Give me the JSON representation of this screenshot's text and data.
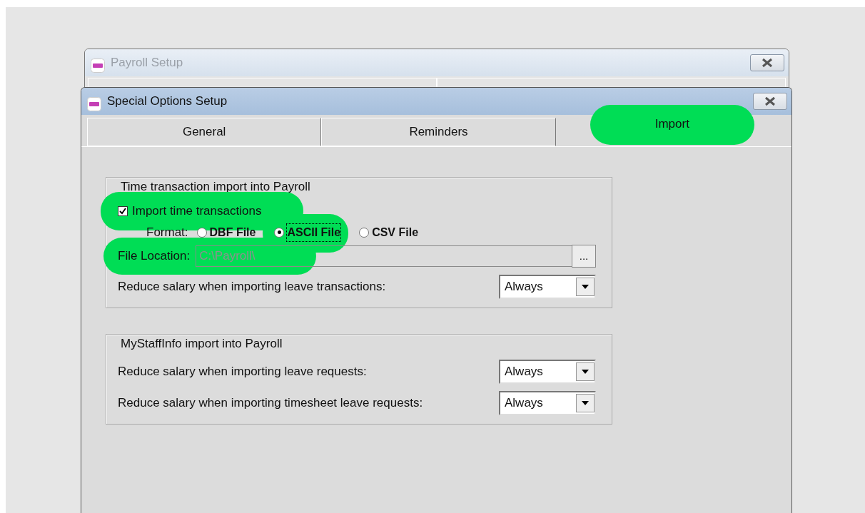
{
  "back_window": {
    "title": "Payroll Setup"
  },
  "window": {
    "title": "Special Options Setup"
  },
  "tabs": [
    {
      "label": "General",
      "selected": false,
      "highlighted": false
    },
    {
      "label": "Reminders",
      "selected": false,
      "highlighted": false
    },
    {
      "label": "Import",
      "selected": true,
      "highlighted": true
    }
  ],
  "groups": [
    {
      "title": "Time transaction import into Payroll",
      "rows": [
        {
          "kind": "checkbox",
          "label": "Import time transactions",
          "checked": true,
          "highlighted": true
        },
        {
          "kind": "radios",
          "label": "Format:",
          "options": [
            {
              "label": "DBF File",
              "selected": false,
              "highlighted": false,
              "focused": false
            },
            {
              "label": "ASCII File",
              "selected": true,
              "highlighted": true,
              "focused": true
            },
            {
              "label": "CSV File",
              "selected": false,
              "highlighted": false,
              "focused": false
            }
          ]
        },
        {
          "kind": "path",
          "label": "File Location:",
          "value": "C:\\Payroll\\",
          "disabled": true,
          "highlighted": true,
          "button": "..."
        },
        {
          "kind": "dropdown",
          "label": "Reduce salary when importing leave transactions:",
          "value": "Always"
        }
      ]
    },
    {
      "title": "MyStaffInfo import into Payroll",
      "rows": [
        {
          "kind": "dropdown",
          "label": "Reduce salary when importing leave requests:",
          "value": "Always"
        },
        {
          "kind": "dropdown",
          "label": "Reduce salary when importing timesheet leave requests:",
          "value": "Always"
        }
      ]
    }
  ]
}
